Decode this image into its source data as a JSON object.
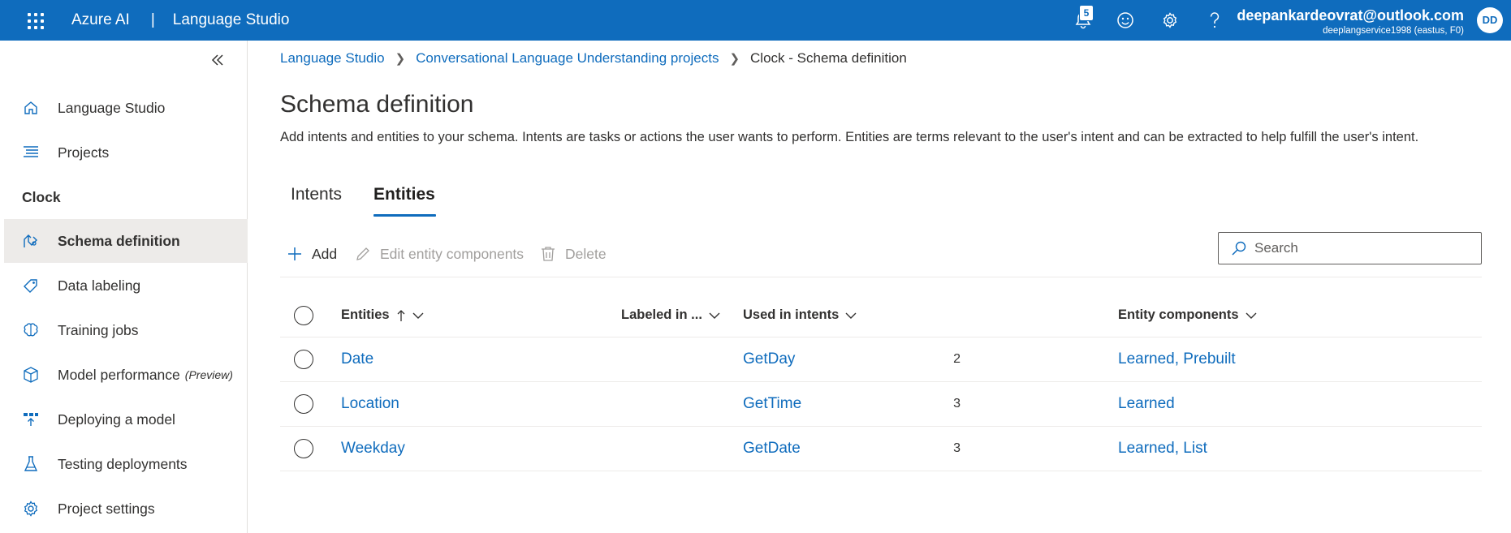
{
  "topbar": {
    "product": "Azure AI",
    "separator": "|",
    "app": "Language Studio",
    "notification_count": "5",
    "user_email": "deepankardeovrat@outlook.com",
    "user_sub": "deeplangservice1998 (eastus, F0)",
    "avatar_initials": "DD"
  },
  "sidebar": {
    "items": [
      {
        "label": "Language Studio",
        "icon": "home-icon"
      },
      {
        "label": "Projects",
        "icon": "list-icon"
      }
    ],
    "section_label": "Clock",
    "project_items": [
      {
        "label": "Schema definition",
        "icon": "schema-icon",
        "active": true
      },
      {
        "label": "Data labeling",
        "icon": "tag-icon"
      },
      {
        "label": "Training jobs",
        "icon": "brain-icon"
      },
      {
        "label": "Model performance",
        "suffix": "(Preview)",
        "icon": "cube-icon"
      },
      {
        "label": "Deploying a model",
        "icon": "deploy-icon"
      },
      {
        "label": "Testing deployments",
        "icon": "flask-icon"
      },
      {
        "label": "Project settings",
        "icon": "gear-icon"
      }
    ]
  },
  "breadcrumb": {
    "items": [
      "Language Studio",
      "Conversational Language Understanding projects"
    ],
    "current": "Clock - Schema definition"
  },
  "page": {
    "title": "Schema definition",
    "description": "Add intents and entities to your schema. Intents are tasks or actions the user wants to perform. Entities are terms relevant to the user's intent and can be extracted to help fulfill the user's intent."
  },
  "tabs": [
    {
      "label": "Intents",
      "active": false
    },
    {
      "label": "Entities",
      "active": true
    }
  ],
  "toolbar": {
    "add_label": "Add",
    "edit_label": "Edit entity components",
    "delete_label": "Delete",
    "search_placeholder": "Search"
  },
  "table": {
    "columns": [
      "Entities",
      "Labeled in ...",
      "Used in intents",
      "Entity components"
    ],
    "rows": [
      {
        "entity": "Date",
        "labeled": "2",
        "intents": "GetDay",
        "components": "Learned, Prebuilt"
      },
      {
        "entity": "Location",
        "labeled": "3",
        "intents": "GetTime",
        "components": "Learned"
      },
      {
        "entity": "Weekday",
        "labeled": "3",
        "intents": "GetDate",
        "components": "Learned, List"
      }
    ]
  },
  "colors": {
    "accent": "#0f6cbd",
    "text": "#323130",
    "disabled": "#a19f9d",
    "selected_bg": "#edebe9"
  }
}
